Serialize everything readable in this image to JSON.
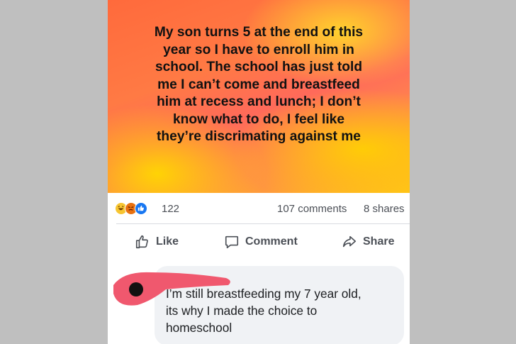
{
  "post": {
    "text": "My son turns 5 at the end of this\nyear so I have to enroll him in\nschool. The school has just told\nme I can’t come and breastfeed\nhim at recess and lunch; I don’t\nknow what to do, I feel like\nthey’re discrimating against me"
  },
  "stats": {
    "reactions": [
      "haha",
      "angry",
      "like"
    ],
    "reaction_count": "122",
    "comments": "107 comments",
    "shares": "8 shares"
  },
  "actions": {
    "like_label": "Like",
    "comment_label": "Comment",
    "share_label": "Share"
  },
  "comment": {
    "text": "I’m still breastfeeding my 7 year old,\nits why I made the choice to\nhomeschool"
  },
  "colors": {
    "like_blue": "#1877f2",
    "redaction_pink": "#f0586e",
    "text_gray": "#4b4f56"
  }
}
